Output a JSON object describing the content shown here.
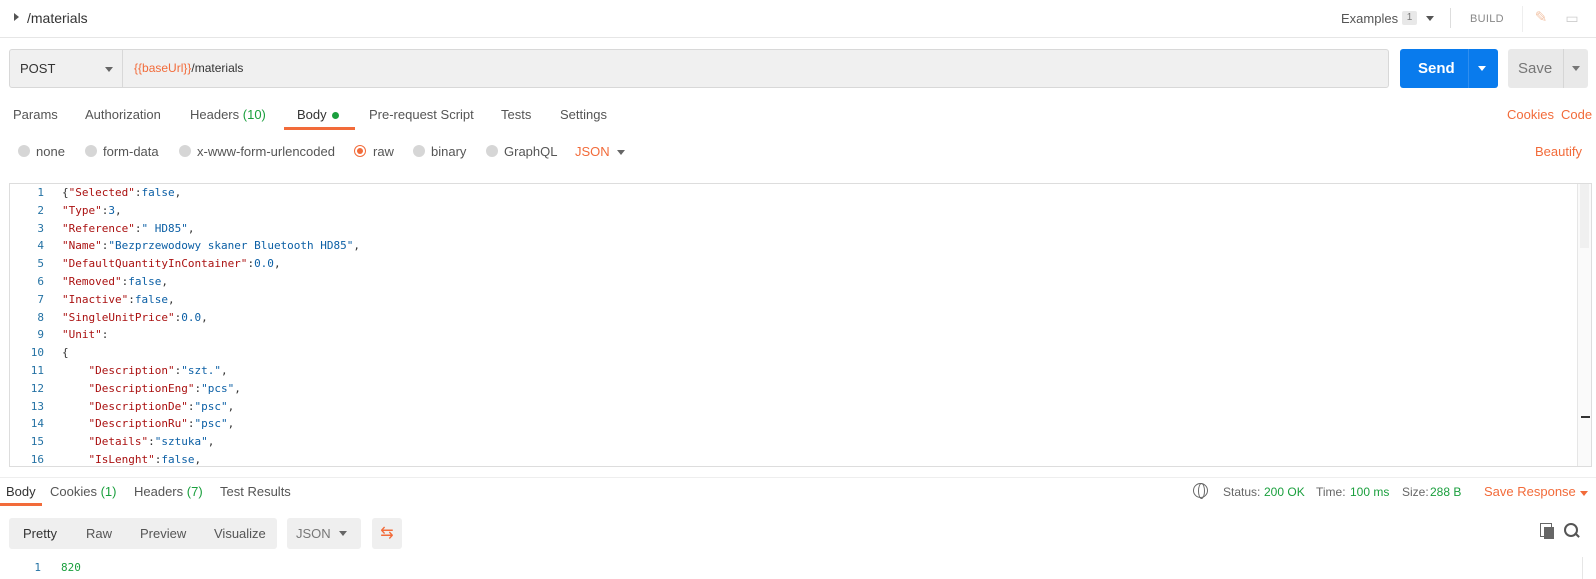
{
  "request": {
    "title": "/materials",
    "examples_label": "Examples",
    "examples_count": "1",
    "build_label": "BUILD",
    "method": "POST",
    "url_var": "{{baseUrl}}",
    "url_path": "/materials",
    "send_label": "Send",
    "save_label": "Save"
  },
  "tabs": {
    "params": "Params",
    "authorization": "Authorization",
    "headers": "Headers",
    "headers_count": "(10)",
    "body": "Body",
    "prerequest": "Pre-request Script",
    "tests": "Tests",
    "settings": "Settings",
    "cookies": "Cookies",
    "code": "Code"
  },
  "body_types": {
    "none": "none",
    "form_data": "form-data",
    "urlencoded": "x-www-form-urlencoded",
    "raw": "raw",
    "binary": "binary",
    "graphql": "GraphQL",
    "raw_format": "JSON",
    "beautify": "Beautify"
  },
  "editor_lines": [
    {
      "n": "1",
      "pre": "{",
      "key": "\"Selected\"",
      "sep": ":",
      "val": "false",
      "post": ","
    },
    {
      "n": "2",
      "pre": "",
      "key": "\"Type\"",
      "sep": ":",
      "val": "3",
      "post": ","
    },
    {
      "n": "3",
      "pre": "",
      "key": "\"Reference\"",
      "sep": ":",
      "val": "\" HD85\"",
      "post": ","
    },
    {
      "n": "4",
      "pre": "",
      "key": "\"Name\"",
      "sep": ":",
      "val": "\"Bezprzewodowy skaner Bluetooth HD85\"",
      "post": ","
    },
    {
      "n": "5",
      "pre": "",
      "key": "\"DefaultQuantityInContainer\"",
      "sep": ":",
      "val": "0.0",
      "post": ","
    },
    {
      "n": "6",
      "pre": "",
      "key": "\"Removed\"",
      "sep": ":",
      "val": "false",
      "post": ","
    },
    {
      "n": "7",
      "pre": "",
      "key": "\"Inactive\"",
      "sep": ":",
      "val": "false",
      "post": ","
    },
    {
      "n": "8",
      "pre": "",
      "key": "\"SingleUnitPrice\"",
      "sep": ":",
      "val": "0.0",
      "post": ","
    },
    {
      "n": "9",
      "pre": "",
      "key": "\"Unit\"",
      "sep": ":",
      "val": "",
      "post": ""
    },
    {
      "n": "10",
      "pre": "{",
      "key": "",
      "sep": "",
      "val": "",
      "post": ""
    },
    {
      "n": "11",
      "pre": "    ",
      "key": "\"Description\"",
      "sep": ":",
      "val": "\"szt.\"",
      "post": ","
    },
    {
      "n": "12",
      "pre": "    ",
      "key": "\"DescriptionEng\"",
      "sep": ":",
      "val": "\"pcs\"",
      "post": ","
    },
    {
      "n": "13",
      "pre": "    ",
      "key": "\"DescriptionDe\"",
      "sep": ":",
      "val": "\"psc\"",
      "post": ","
    },
    {
      "n": "14",
      "pre": "    ",
      "key": "\"DescriptionRu\"",
      "sep": ":",
      "val": "\"psc\"",
      "post": ","
    },
    {
      "n": "15",
      "pre": "    ",
      "key": "\"Details\"",
      "sep": ":",
      "val": "\"sztuka\"",
      "post": ","
    },
    {
      "n": "16",
      "pre": "    ",
      "key": "\"IsLenght\"",
      "sep": ":",
      "val": "false",
      "post": ","
    }
  ],
  "response": {
    "tab_body": "Body",
    "tab_cookies": "Cookies",
    "cookies_count": "(1)",
    "tab_headers": "Headers",
    "headers_count": "(7)",
    "tab_tests": "Test Results",
    "status_label": "Status:",
    "status_value": "200 OK",
    "time_label": "Time:",
    "time_value": "100 ms",
    "size_label": "Size:",
    "size_value": "288 B",
    "save_response": "Save Response",
    "view_pretty": "Pretty",
    "view_raw": "Raw",
    "view_preview": "Preview",
    "view_visualize": "Visualize",
    "format": "JSON",
    "line_number": "1",
    "value": "820"
  }
}
